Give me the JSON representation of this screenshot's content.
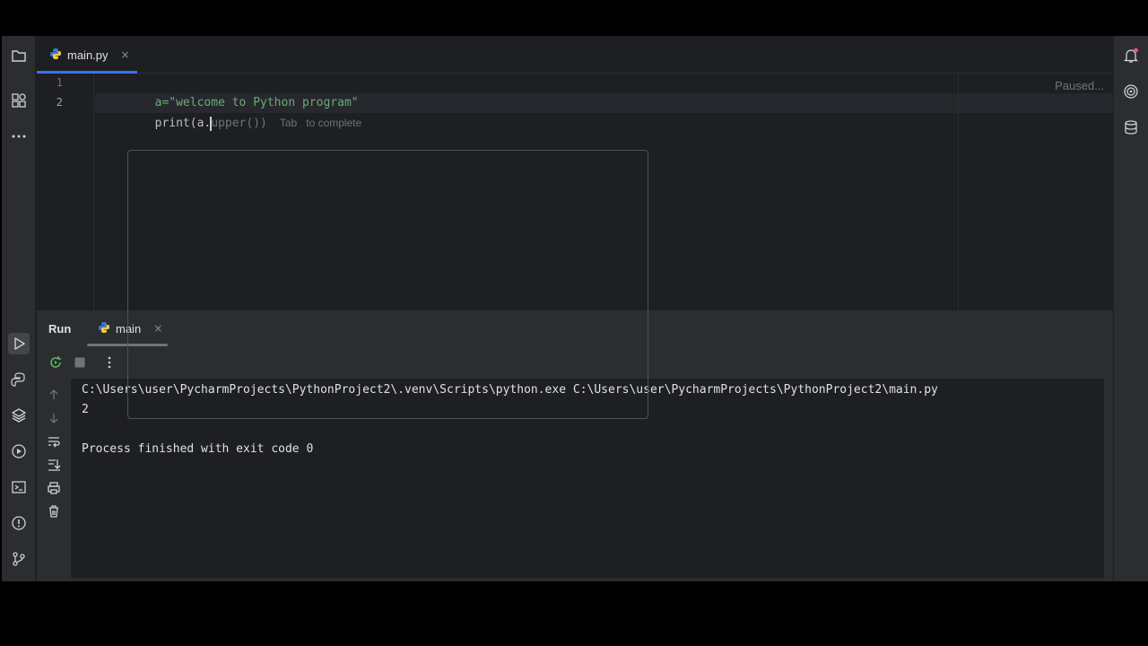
{
  "editor": {
    "tab": {
      "label": "main.py",
      "close": "×"
    },
    "line_numbers": [
      "1",
      "2"
    ],
    "line1": "a=\"welcome to Python program\"",
    "line2_before_caret": "print(a.",
    "line2_after_caret": "upper())",
    "completion_hint_key": "Tab",
    "completion_hint_text": "to complete",
    "status": "Paused..."
  },
  "run": {
    "title": "Run",
    "tab": {
      "label": "main",
      "close": "×"
    },
    "console_lines": [
      "C:\\Users\\user\\PycharmProjects\\PythonProject2\\.venv\\Scripts\\python.exe C:\\Users\\user\\PycharmProjects\\PythonProject2\\main.py",
      "2",
      "",
      "Process finished with exit code 0"
    ]
  },
  "icons": {
    "left_strip": [
      "folder-icon",
      "structure-icon",
      "more-icon",
      "run-icon",
      "python-console-icon",
      "layers-icon",
      "services-icon",
      "terminal-icon",
      "problems-icon",
      "git-icon"
    ],
    "right_strip": [
      "notifications-icon",
      "ai-assistant-icon",
      "database-icon"
    ],
    "run_toolbar": [
      "rerun-icon",
      "stop-icon",
      "options-icon"
    ],
    "run_side": [
      "scroll-up-icon",
      "scroll-down-icon",
      "soft-wrap-icon",
      "scroll-to-end-icon",
      "print-icon",
      "clear-icon"
    ]
  },
  "colors": {
    "accent": "#3574f0",
    "string": "#6aab73",
    "notification_dot": "#e55765"
  }
}
